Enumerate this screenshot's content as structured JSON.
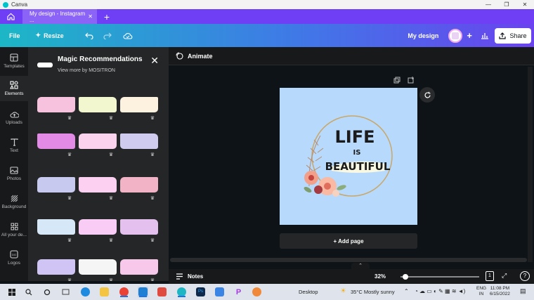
{
  "window": {
    "title": "Canva"
  },
  "tabs": [
    {
      "label": "My design - Instagram ..."
    }
  ],
  "toolbar": {
    "file": "File",
    "resize": "Resize",
    "design_name": "My design",
    "share": "Share"
  },
  "rail": [
    {
      "label": "Templates",
      "icon": "templates-icon"
    },
    {
      "label": "Elements",
      "icon": "elements-icon",
      "active": true
    },
    {
      "label": "Uploads",
      "icon": "uploads-icon"
    },
    {
      "label": "Text",
      "icon": "text-icon"
    },
    {
      "label": "Photos",
      "icon": "photos-icon"
    },
    {
      "label": "Background",
      "icon": "background-icon"
    },
    {
      "label": "All your de...",
      "icon": "apps-icon"
    },
    {
      "label": "Logos",
      "icon": "logos-icon"
    }
  ],
  "panel": {
    "title": "Magic Recommendations",
    "subtitle": "View more by MOSITRON",
    "swatch_colors": [
      [
        "#f6c2dd",
        "#f3f7cf",
        "#fdf1e0"
      ],
      [
        "#e38ae6",
        "#fbd3ef",
        "#cfcbef"
      ],
      [
        "#c8c9ef",
        "#fcd0f1",
        "#f2b3c6"
      ],
      [
        "#d6e8f7",
        "#f8ccf4",
        "#e3c0ee"
      ],
      [
        "#d0c4f5",
        "#f5f5f5",
        "#f8c8ea"
      ]
    ]
  },
  "editor": {
    "animate": "Animate",
    "add_page": "+ Add page",
    "canvas_bg": "#b7dafc",
    "quote": {
      "line1": "LIFE",
      "line2": "IS",
      "line3": "BEAUTIFUL"
    }
  },
  "bottom": {
    "notes": "Notes",
    "zoom": "32%",
    "zoom_level": 0.06,
    "page_number": "1"
  },
  "taskbar": {
    "desktop": "Desktop",
    "weather": "35°C  Mostly sunny",
    "lang1": "ENG",
    "lang2": "IN",
    "time": "11:08 PM",
    "date": "6/15/2022"
  }
}
